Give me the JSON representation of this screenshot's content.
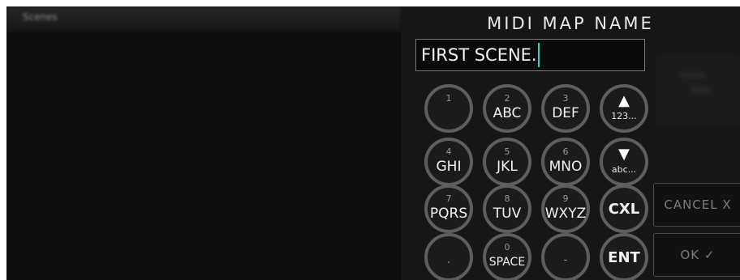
{
  "left": {
    "header_label": "Scenes"
  },
  "dialog": {
    "title": "MIDI MAP NAME",
    "name_value": "FIRST SCENE."
  },
  "background_panel": {
    "line1": "Scene",
    "line2": "Save"
  },
  "keypad": {
    "keys": [
      {
        "num": "1",
        "letters": ""
      },
      {
        "num": "2",
        "letters": "ABC"
      },
      {
        "num": "3",
        "letters": "DEF"
      },
      {
        "arrow": "▲",
        "sub": "123..."
      },
      {
        "num": "4",
        "letters": "GHI"
      },
      {
        "num": "5",
        "letters": "JKL"
      },
      {
        "num": "6",
        "letters": "MNO"
      },
      {
        "arrow": "▼",
        "sub": "abc..."
      },
      {
        "num": "7",
        "letters": "PQRS"
      },
      {
        "num": "8",
        "letters": "TUV"
      },
      {
        "num": "9",
        "letters": "WXYZ"
      },
      {
        "label": "CXL"
      },
      {
        "num": ".",
        "letters": ""
      },
      {
        "num": "0",
        "letters": "SPACE"
      },
      {
        "num": "-",
        "letters": ""
      },
      {
        "label": "ENT"
      }
    ]
  },
  "buttons": {
    "cancel": "CANCEL X",
    "ok": "OK ✓"
  },
  "colors": {
    "cursor": "#19e0c8",
    "key_ring": "#5e5e5e",
    "background": "#0b0b0b"
  }
}
